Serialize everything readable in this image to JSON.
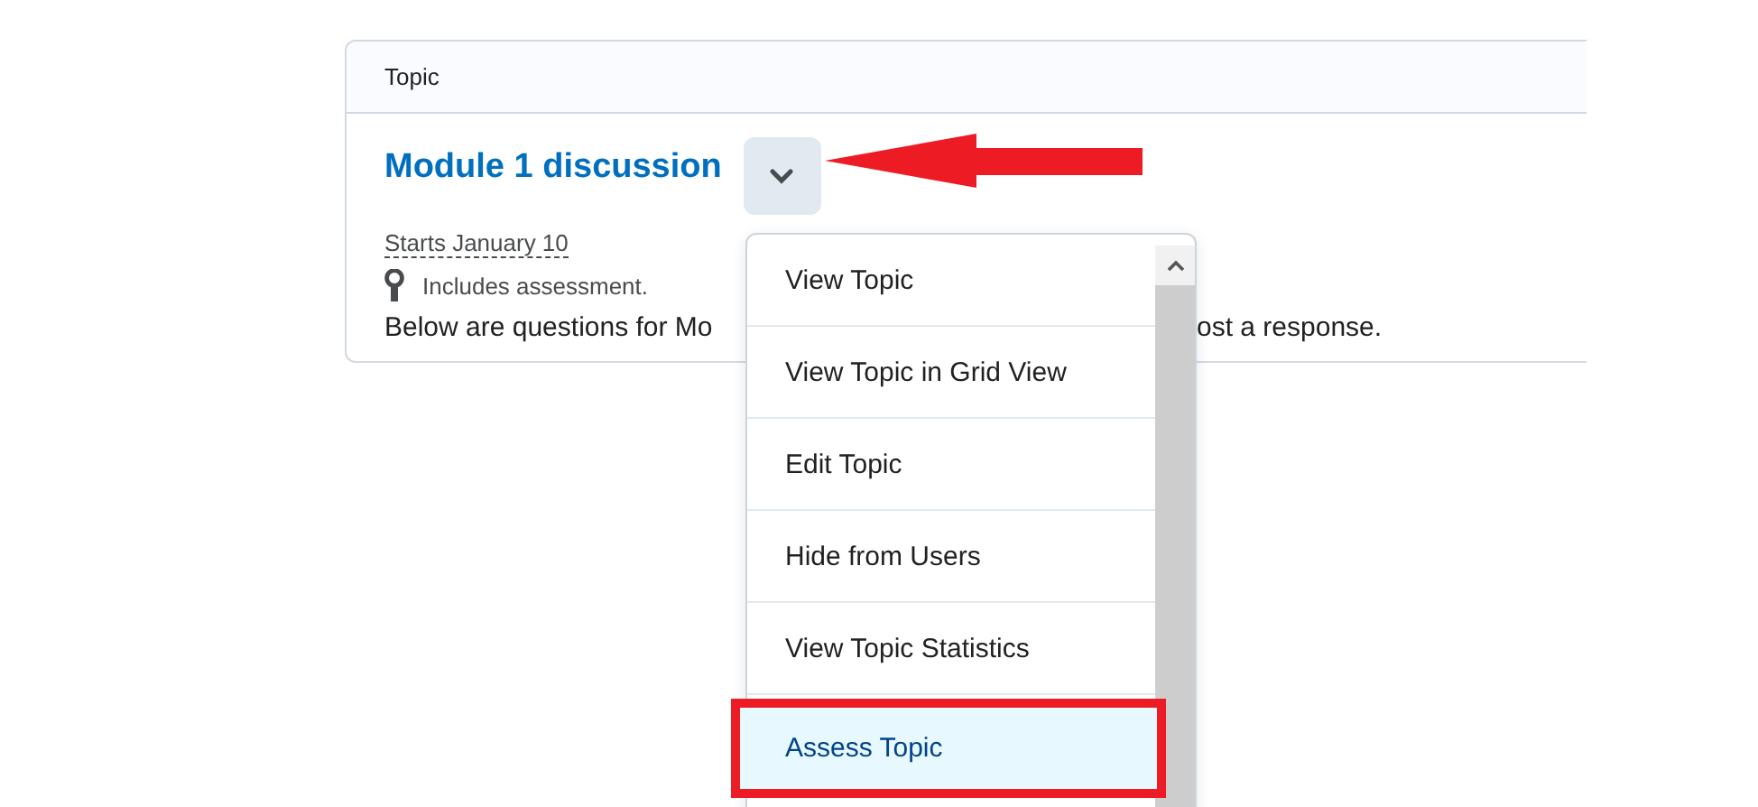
{
  "card": {
    "header": "Topic",
    "title": "Module 1 discussion",
    "starts": "Starts January 10",
    "assessment": "Includes assessment.",
    "description_left": "Below are questions for Mo",
    "description_right": "ost a response."
  },
  "menu": {
    "items": [
      {
        "label": "View Topic",
        "selected": false
      },
      {
        "label": "View Topic in Grid View",
        "selected": false
      },
      {
        "label": "Edit Topic",
        "selected": false
      },
      {
        "label": "Hide from Users",
        "selected": false
      },
      {
        "label": "View Topic Statistics",
        "selected": false
      },
      {
        "label": "Assess Topic",
        "selected": true
      }
    ]
  }
}
